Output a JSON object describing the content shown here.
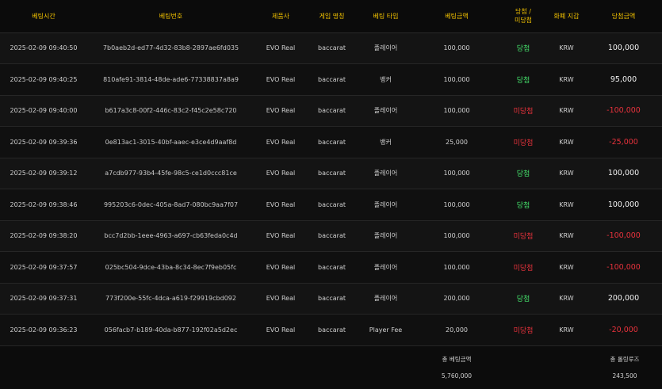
{
  "columns": [
    "베팅시간",
    "베팅번호",
    "제품사",
    "게임 명칭",
    "베팅 타입",
    "베팅금액",
    "당첨 /\n미당첨",
    "화폐 지갑",
    "당첨금액"
  ],
  "rows": [
    {
      "time": "2025-02-09 09:40:50",
      "id": "7b0aeb2d-ed77-4d32-83b8-2897ae6fd035",
      "vendor": "EVO Real",
      "game": "baccarat",
      "bet_type": "플레이어",
      "bet_amount": "100,000",
      "result": "당첨",
      "result_kind": "win",
      "currency": "KRW",
      "win_amount": "100,000"
    },
    {
      "time": "2025-02-09 09:40:25",
      "id": "810afe91-3814-48de-ade6-77338837a8a9",
      "vendor": "EVO Real",
      "game": "baccarat",
      "bet_type": "뱅커",
      "bet_amount": "100,000",
      "result": "당첨",
      "result_kind": "win",
      "currency": "KRW",
      "win_amount": "95,000"
    },
    {
      "time": "2025-02-09 09:40:00",
      "id": "b617a3c8-00f2-446c-83c2-f45c2e58c720",
      "vendor": "EVO Real",
      "game": "baccarat",
      "bet_type": "플레이어",
      "bet_amount": "100,000",
      "result": "미당첨",
      "result_kind": "lose",
      "currency": "KRW",
      "win_amount": "-100,000"
    },
    {
      "time": "2025-02-09 09:39:36",
      "id": "0e813ac1-3015-40bf-aaec-e3ce4d9aaf8d",
      "vendor": "EVO Real",
      "game": "baccarat",
      "bet_type": "뱅커",
      "bet_amount": "25,000",
      "result": "미당첨",
      "result_kind": "lose",
      "currency": "KRW",
      "win_amount": "-25,000"
    },
    {
      "time": "2025-02-09 09:39:12",
      "id": "a7cdb977-93b4-45fe-98c5-ce1d0ccc81ce",
      "vendor": "EVO Real",
      "game": "baccarat",
      "bet_type": "플레이어",
      "bet_amount": "100,000",
      "result": "당첨",
      "result_kind": "win",
      "currency": "KRW",
      "win_amount": "100,000"
    },
    {
      "time": "2025-02-09 09:38:46",
      "id": "995203c6-0dec-405a-8ad7-080bc9aa7f07",
      "vendor": "EVO Real",
      "game": "baccarat",
      "bet_type": "플레이어",
      "bet_amount": "100,000",
      "result": "당첨",
      "result_kind": "win",
      "currency": "KRW",
      "win_amount": "100,000"
    },
    {
      "time": "2025-02-09 09:38:20",
      "id": "bcc7d2bb-1eee-4963-a697-cb63feda0c4d",
      "vendor": "EVO Real",
      "game": "baccarat",
      "bet_type": "플레이어",
      "bet_amount": "100,000",
      "result": "미당첨",
      "result_kind": "lose",
      "currency": "KRW",
      "win_amount": "-100,000"
    },
    {
      "time": "2025-02-09 09:37:57",
      "id": "025bc504-9dce-43ba-8c34-8ec7f9eb05fc",
      "vendor": "EVO Real",
      "game": "baccarat",
      "bet_type": "플레이어",
      "bet_amount": "100,000",
      "result": "미당첨",
      "result_kind": "lose",
      "currency": "KRW",
      "win_amount": "-100,000"
    },
    {
      "time": "2025-02-09 09:37:31",
      "id": "773f200e-55fc-4dca-a619-f29919cbd092",
      "vendor": "EVO Real",
      "game": "baccarat",
      "bet_type": "플레이어",
      "bet_amount": "200,000",
      "result": "당첨",
      "result_kind": "win",
      "currency": "KRW",
      "win_amount": "200,000"
    },
    {
      "time": "2025-02-09 09:36:23",
      "id": "056facb7-b189-40da-b877-192f02a5d2ec",
      "vendor": "EVO Real",
      "game": "baccarat",
      "bet_type": "Player Fee",
      "bet_amount": "20,000",
      "result": "미당첨",
      "result_kind": "lose",
      "currency": "KRW",
      "win_amount": "-20,000"
    }
  ],
  "summary": {
    "total_bet_label": "총 베팅금액",
    "total_bet_value": "5,760,000",
    "total_rolling_label": "총 롤링루즈",
    "total_rolling_value": "243,500"
  },
  "colors": {
    "header_text": "#f2c200",
    "win": "#44e06a",
    "lose": "#e8323c",
    "background": "#101010"
  }
}
